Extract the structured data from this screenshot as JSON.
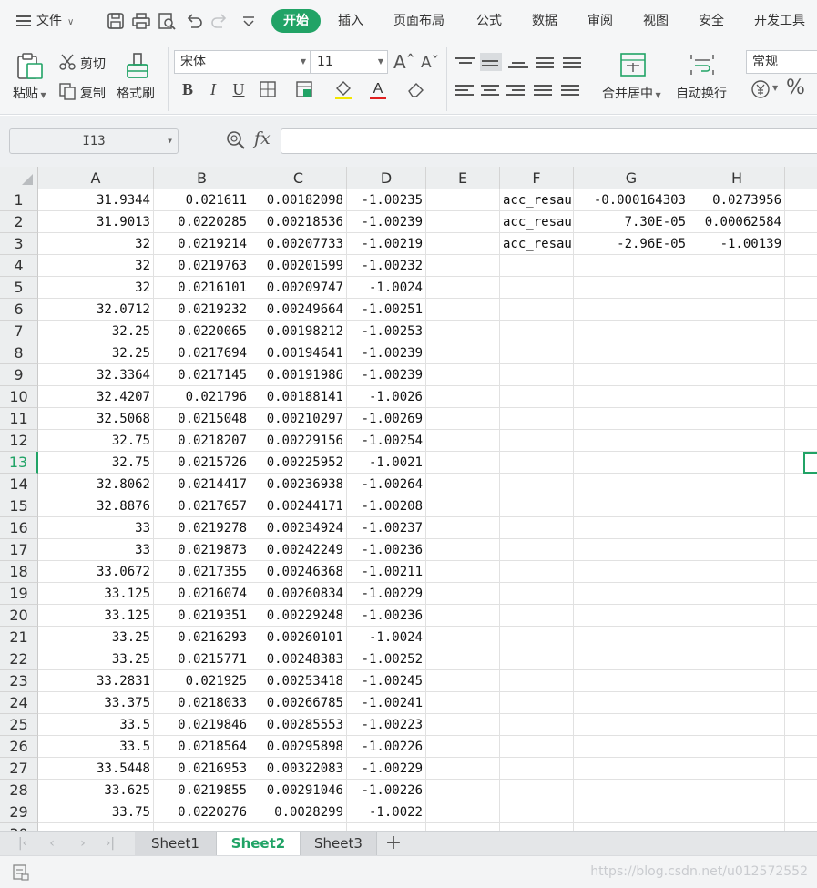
{
  "menubar": {
    "file_label": "文件",
    "tabs": [
      "开始",
      "插入",
      "页面布局",
      "公式",
      "数据",
      "审阅",
      "视图",
      "安全",
      "开发工具"
    ],
    "active_tab": "开始"
  },
  "ribbon": {
    "paste": "粘贴",
    "cut": "剪切",
    "copy": "复制",
    "format_painter": "格式刷",
    "font_name": "宋体",
    "font_size": "11",
    "merge_center": "合并居中",
    "wrap_text": "自动换行",
    "number_format": "常规",
    "bold": "B",
    "italic": "I",
    "underline": "U",
    "font_color_letter": "A"
  },
  "formula_bar": {
    "name_box": "I13",
    "fx": "fx",
    "formula": ""
  },
  "grid": {
    "columns": [
      "A",
      "B",
      "C",
      "D",
      "E",
      "F",
      "G",
      "H"
    ],
    "active_row": 13,
    "rows": [
      [
        "31.9344",
        "0.021611",
        "0.00182098",
        "-1.00235",
        "",
        "acc_resau",
        "-0.000164303",
        "0.0273956"
      ],
      [
        "31.9013",
        "0.0220285",
        "0.00218536",
        "-1.00239",
        "",
        "acc_resau",
        "7.30E-05",
        "0.00062584"
      ],
      [
        "32",
        "0.0219214",
        "0.00207733",
        "-1.00219",
        "",
        "acc_resau",
        "-2.96E-05",
        "-1.00139"
      ],
      [
        "32",
        "0.0219763",
        "0.00201599",
        "-1.00232",
        "",
        "",
        "",
        ""
      ],
      [
        "32",
        "0.0216101",
        "0.00209747",
        "-1.0024",
        "",
        "",
        "",
        ""
      ],
      [
        "32.0712",
        "0.0219232",
        "0.00249664",
        "-1.00251",
        "",
        "",
        "",
        ""
      ],
      [
        "32.25",
        "0.0220065",
        "0.00198212",
        "-1.00253",
        "",
        "",
        "",
        ""
      ],
      [
        "32.25",
        "0.0217694",
        "0.00194641",
        "-1.00239",
        "",
        "",
        "",
        ""
      ],
      [
        "32.3364",
        "0.0217145",
        "0.00191986",
        "-1.00239",
        "",
        "",
        "",
        ""
      ],
      [
        "32.4207",
        "0.021796",
        "0.00188141",
        "-1.0026",
        "",
        "",
        "",
        ""
      ],
      [
        "32.5068",
        "0.0215048",
        "0.00210297",
        "-1.00269",
        "",
        "",
        "",
        ""
      ],
      [
        "32.75",
        "0.0218207",
        "0.00229156",
        "-1.00254",
        "",
        "",
        "",
        ""
      ],
      [
        "32.75",
        "0.0215726",
        "0.00225952",
        "-1.0021",
        "",
        "",
        "",
        ""
      ],
      [
        "32.8062",
        "0.0214417",
        "0.00236938",
        "-1.00264",
        "",
        "",
        "",
        ""
      ],
      [
        "32.8876",
        "0.0217657",
        "0.00244171",
        "-1.00208",
        "",
        "",
        "",
        ""
      ],
      [
        "33",
        "0.0219278",
        "0.00234924",
        "-1.00237",
        "",
        "",
        "",
        ""
      ],
      [
        "33",
        "0.0219873",
        "0.00242249",
        "-1.00236",
        "",
        "",
        "",
        ""
      ],
      [
        "33.0672",
        "0.0217355",
        "0.00246368",
        "-1.00211",
        "",
        "",
        "",
        ""
      ],
      [
        "33.125",
        "0.0216074",
        "0.00260834",
        "-1.00229",
        "",
        "",
        "",
        ""
      ],
      [
        "33.125",
        "0.0219351",
        "0.00229248",
        "-1.00236",
        "",
        "",
        "",
        ""
      ],
      [
        "33.25",
        "0.0216293",
        "0.00260101",
        "-1.0024",
        "",
        "",
        "",
        ""
      ],
      [
        "33.25",
        "0.0215771",
        "0.00248383",
        "-1.00252",
        "",
        "",
        "",
        ""
      ],
      [
        "33.2831",
        "0.021925",
        "0.00253418",
        "-1.00245",
        "",
        "",
        "",
        ""
      ],
      [
        "33.375",
        "0.0218033",
        "0.00266785",
        "-1.00241",
        "",
        "",
        "",
        ""
      ],
      [
        "33.5",
        "0.0219846",
        "0.00285553",
        "-1.00223",
        "",
        "",
        "",
        ""
      ],
      [
        "33.5",
        "0.0218564",
        "0.00295898",
        "-1.00226",
        "",
        "",
        "",
        ""
      ],
      [
        "33.5448",
        "0.0216953",
        "0.00322083",
        "-1.00229",
        "",
        "",
        "",
        ""
      ],
      [
        "33.625",
        "0.0219855",
        "0.00291046",
        "-1.00226",
        "",
        "",
        "",
        ""
      ],
      [
        "33.75",
        "0.0220276",
        "0.0028299",
        "-1.0022",
        "",
        "",
        "",
        ""
      ]
    ]
  },
  "sheets": {
    "tabs": [
      "Sheet1",
      "Sheet2",
      "Sheet3"
    ],
    "active": "Sheet2",
    "add": "+"
  },
  "status": {
    "watermark": "https://blog.csdn.net/u012572552"
  }
}
